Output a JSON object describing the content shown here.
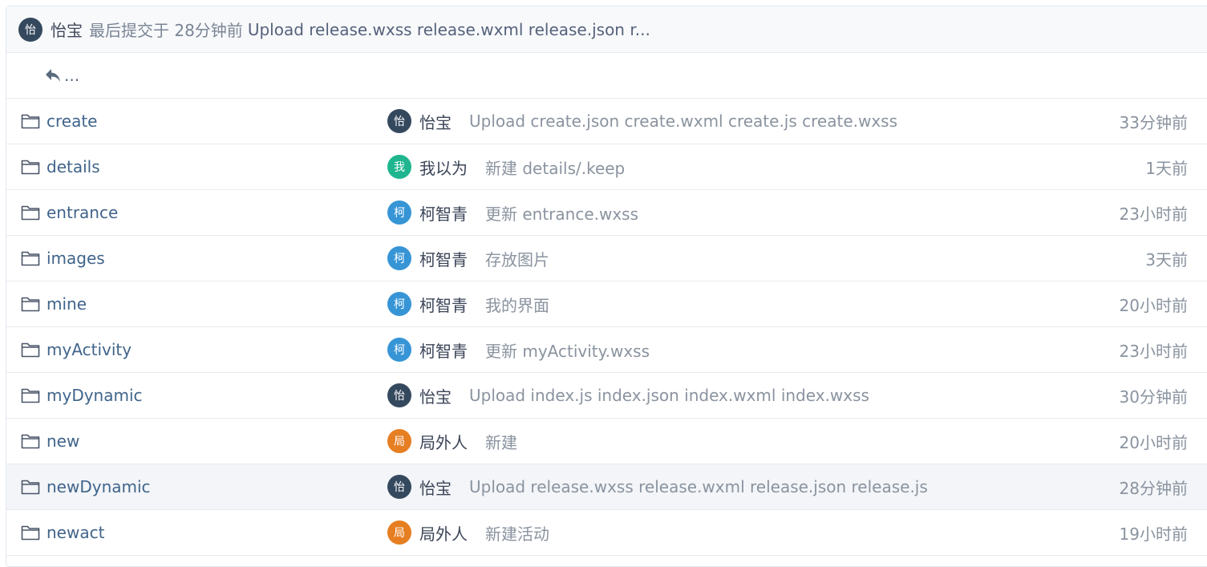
{
  "latest_commit": {
    "avatar_char": "怡",
    "avatar_color": "#35495e",
    "author": "怡宝",
    "meta": "最后提交于 28分钟前",
    "message": "Upload release.wxss release.wxml release.json r..."
  },
  "back": {
    "label": "..."
  },
  "files": [
    {
      "name": "create",
      "avatar_char": "怡",
      "avatar_color": "#35495e",
      "author": "怡宝",
      "message": "Upload create.json create.wxml create.js create.wxss",
      "time": "33分钟前"
    },
    {
      "name": "details",
      "avatar_char": "我",
      "avatar_color": "#1fb68f",
      "author": "我以为",
      "message": "新建 details/.keep",
      "time": "1天前"
    },
    {
      "name": "entrance",
      "avatar_char": "柯",
      "avatar_color": "#3795d6",
      "author": "柯智青",
      "message": "更新 entrance.wxss",
      "time": "23小时前"
    },
    {
      "name": "images",
      "avatar_char": "柯",
      "avatar_color": "#3795d6",
      "author": "柯智青",
      "message": "存放图片",
      "time": "3天前"
    },
    {
      "name": "mine",
      "avatar_char": "柯",
      "avatar_color": "#3795d6",
      "author": "柯智青",
      "message": "我的界面",
      "time": "20小时前"
    },
    {
      "name": "myActivity",
      "avatar_char": "柯",
      "avatar_color": "#3795d6",
      "author": "柯智青",
      "message": "更新 myActivity.wxss",
      "time": "23小时前"
    },
    {
      "name": "myDynamic",
      "avatar_char": "怡",
      "avatar_color": "#35495e",
      "author": "怡宝",
      "message": "Upload index.js index.json index.wxml index.wxss",
      "time": "30分钟前"
    },
    {
      "name": "new",
      "avatar_char": "局",
      "avatar_color": "#e67e22",
      "author": "局外人",
      "message": "新建",
      "time": "20小时前"
    },
    {
      "name": "newDynamic",
      "avatar_char": "怡",
      "avatar_color": "#35495e",
      "author": "怡宝",
      "message": "Upload release.wxss release.wxml release.json release.js",
      "time": "28分钟前"
    },
    {
      "name": "newact",
      "avatar_char": "局",
      "avatar_color": "#e67e22",
      "author": "局外人",
      "message": "新建活动",
      "time": "19小时前"
    }
  ]
}
